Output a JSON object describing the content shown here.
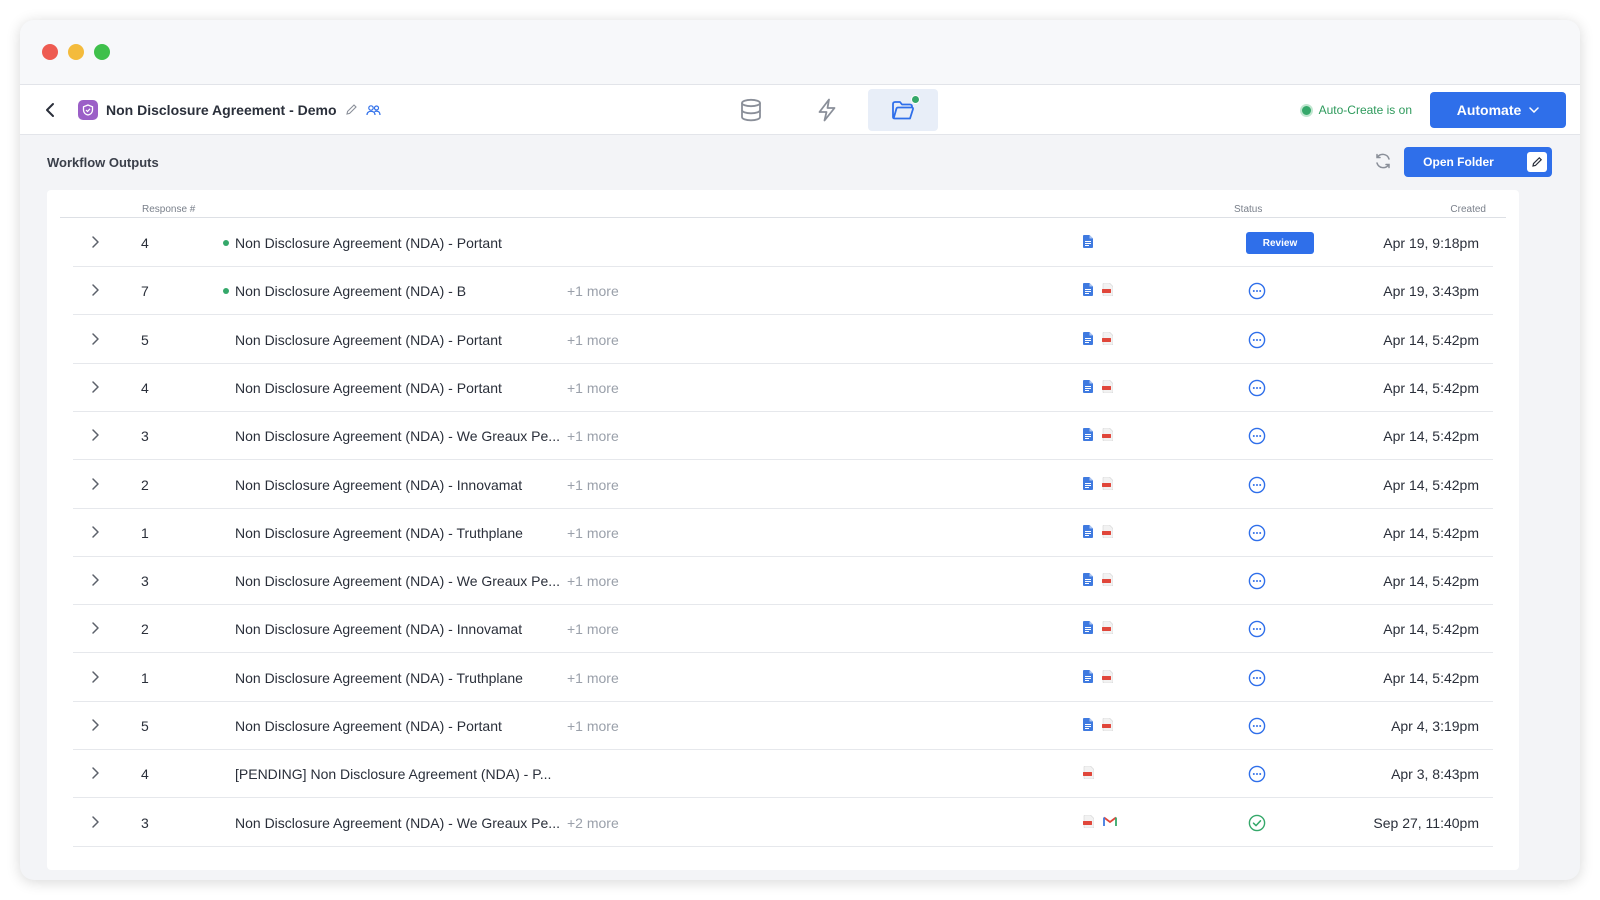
{
  "window": {
    "traffic_lights": [
      "#ee5b51",
      "#f4bb3c",
      "#3fc04b"
    ]
  },
  "appbar": {
    "title": "Non Disclosure Agreement - Demo",
    "badge_color": "#9b5fc7",
    "tabs": [
      {
        "icon": "database-icon"
      },
      {
        "icon": "lightning-icon"
      },
      {
        "icon": "folder-icon",
        "active": true
      }
    ],
    "auto_create_label": "Auto-Create is on",
    "automate_label": "Automate"
  },
  "section": {
    "title": "Workflow Outputs",
    "open_folder_label": "Open Folder"
  },
  "table": {
    "columns": {
      "response": "Response #",
      "status": "Status",
      "created": "Created"
    },
    "rows": [
      {
        "num": "4",
        "dot": true,
        "name": "Non Disclosure Agreement (NDA) - Portant",
        "more": "",
        "files": [
          "doc"
        ],
        "status": "review",
        "status_label": "Review",
        "created": "Apr 19, 9:18pm"
      },
      {
        "num": "7",
        "dot": true,
        "name": "Non Disclosure Agreement (NDA) - B",
        "more": "+1 more",
        "files": [
          "doc",
          "pdf"
        ],
        "status": "pending",
        "created": "Apr 19, 3:43pm"
      },
      {
        "num": "5",
        "dot": false,
        "name": "Non Disclosure Agreement (NDA) - Portant",
        "more": "+1 more",
        "files": [
          "doc",
          "pdf"
        ],
        "status": "pending",
        "created": "Apr 14, 5:42pm"
      },
      {
        "num": "4",
        "dot": false,
        "name": "Non Disclosure Agreement (NDA) - Portant",
        "more": "+1 more",
        "files": [
          "doc",
          "pdf"
        ],
        "status": "pending",
        "created": "Apr 14, 5:42pm"
      },
      {
        "num": "3",
        "dot": false,
        "name": "Non Disclosure Agreement (NDA) - We Greaux Pe...",
        "more": "+1 more",
        "files": [
          "doc",
          "pdf"
        ],
        "status": "pending",
        "created": "Apr 14, 5:42pm"
      },
      {
        "num": "2",
        "dot": false,
        "name": "Non Disclosure Agreement (NDA) - Innovamat",
        "more": "+1 more",
        "files": [
          "doc",
          "pdf"
        ],
        "status": "pending",
        "created": "Apr 14, 5:42pm"
      },
      {
        "num": "1",
        "dot": false,
        "name": "Non Disclosure Agreement (NDA) - Truthplane",
        "more": "+1 more",
        "files": [
          "doc",
          "pdf"
        ],
        "status": "pending",
        "created": "Apr 14, 5:42pm"
      },
      {
        "num": "3",
        "dot": false,
        "name": "Non Disclosure Agreement (NDA) - We Greaux Pe...",
        "more": "+1 more",
        "files": [
          "doc",
          "pdf"
        ],
        "status": "pending",
        "created": "Apr 14, 5:42pm"
      },
      {
        "num": "2",
        "dot": false,
        "name": "Non Disclosure Agreement (NDA) - Innovamat",
        "more": "+1 more",
        "files": [
          "doc",
          "pdf"
        ],
        "status": "pending",
        "created": "Apr 14, 5:42pm"
      },
      {
        "num": "1",
        "dot": false,
        "name": "Non Disclosure Agreement (NDA) - Truthplane",
        "more": "+1 more",
        "files": [
          "doc",
          "pdf"
        ],
        "status": "pending",
        "created": "Apr 14, 5:42pm"
      },
      {
        "num": "5",
        "dot": false,
        "name": "Non Disclosure Agreement (NDA) - Portant",
        "more": "+1 more",
        "files": [
          "doc",
          "pdf"
        ],
        "status": "pending",
        "created": "Apr 4, 3:19pm"
      },
      {
        "num": "4",
        "dot": false,
        "name": "[PENDING] Non Disclosure Agreement (NDA) - P...",
        "more": "",
        "files": [
          "pdf"
        ],
        "status": "pending",
        "created": "Apr 3, 8:43pm"
      },
      {
        "num": "3",
        "dot": false,
        "name": "Non Disclosure Agreement (NDA) - We Greaux Pe...",
        "more": "+2 more",
        "files": [
          "pdf",
          "gmail"
        ],
        "status": "done",
        "created": "Sep 27, 11:40pm"
      }
    ]
  },
  "colors": {
    "accent": "#2f6fea",
    "success": "#35a86a"
  }
}
